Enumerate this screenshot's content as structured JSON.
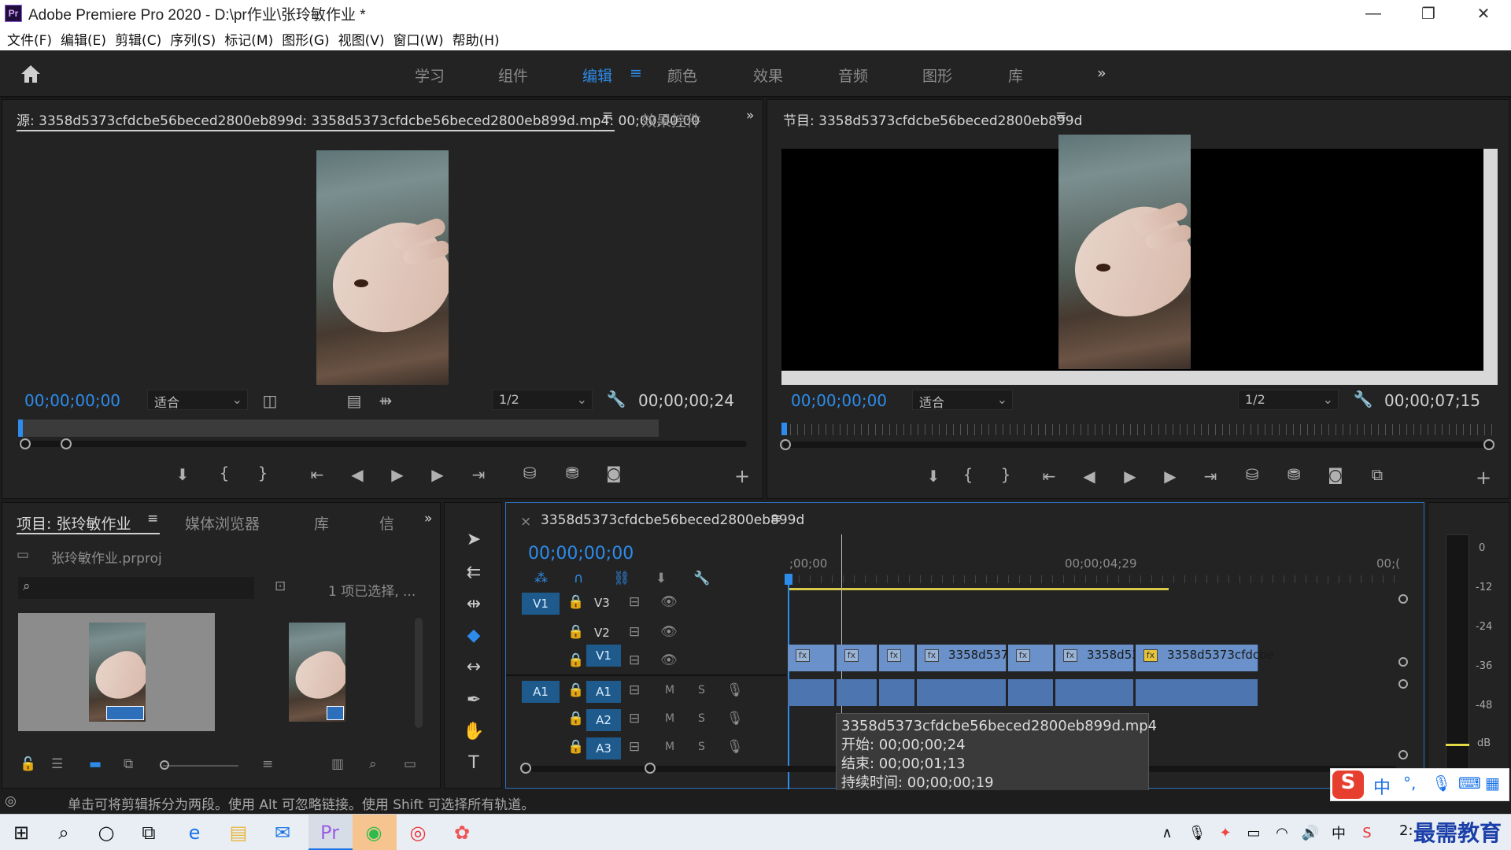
{
  "window": {
    "title": "Adobe Premiere Pro 2020 - D:\\pr作业\\张玲敏作业 *",
    "logo": "Pr",
    "minimize_glyph": "—",
    "restore_glyph": "❐",
    "close_glyph": "✕"
  },
  "menu": [
    "文件(F)",
    "编辑(E)",
    "剪辑(C)",
    "序列(S)",
    "标记(M)",
    "图形(G)",
    "视图(V)",
    "窗口(W)",
    "帮助(H)"
  ],
  "workspace": {
    "tabs": [
      "学习",
      "组件",
      "编辑",
      "颜色",
      "效果",
      "音频",
      "图形",
      "库"
    ],
    "active": "编辑",
    "more": "»",
    "menu_glyph": "≡"
  },
  "source_monitor": {
    "tab_label": "源: 3358d5373cfdcbe56beced2800eb899d: 3358d5373cfdcbe56beced2800eb899d.mp4: 00;00;00;00",
    "effects_tab": "效果控件",
    "timecode": "00;00;00;00",
    "fit": "适合",
    "resolution": "1/2",
    "duration": "00;00;00;24"
  },
  "program_monitor": {
    "tab_label": "节目: 3358d5373cfdcbe56beced2800eb899d",
    "timecode": "00;00;00;00",
    "fit": "适合",
    "resolution": "1/2",
    "duration": "00;00;07;15"
  },
  "project_panel": {
    "tabs": [
      "项目: 张玲敏作业",
      "媒体浏览器",
      "库",
      "信"
    ],
    "file": "张玲敏作业.prproj",
    "selection": "1 项已选择, ..."
  },
  "timeline": {
    "sequence": "3358d5373cfdcbe56beced2800eb899d",
    "timecode": "00;00;00;00",
    "ruler": [
      ";00;00",
      "00;00;04;29",
      "00;("
    ],
    "video_tracks": [
      {
        "src": "V1",
        "name": "V3"
      },
      {
        "src": "",
        "name": "V2"
      },
      {
        "src": "",
        "name": "V1"
      }
    ],
    "audio_tracks": [
      {
        "src": "A1",
        "name": "A1"
      },
      {
        "src": "",
        "name": "A2"
      },
      {
        "src": "",
        "name": "A3"
      }
    ],
    "clip_labels": [
      "3358d537",
      "3358d53",
      "3358d5373cfdcbe"
    ],
    "track_m": "M",
    "track_s": "S"
  },
  "tooltip": {
    "name": "3358d5373cfdcbe56beced2800eb899d.mp4",
    "start": "开始: 00;00;00;24",
    "end": "结束: 00;00;01;13",
    "duration": "持续时间: 00;00;00;19"
  },
  "meter": {
    "labels": [
      "0",
      "-12",
      "-24",
      "-36",
      "-48",
      "dB"
    ]
  },
  "status": {
    "text": "单击可将剪辑拆分为两段。使用 Alt 可忽略链接。使用 Shift 可选择所有轨道。"
  },
  "ime": {
    "labels": [
      "中",
      "°,",
      "⌨"
    ]
  },
  "watermark": "最需教育",
  "tray": {
    "time": "2:"
  }
}
